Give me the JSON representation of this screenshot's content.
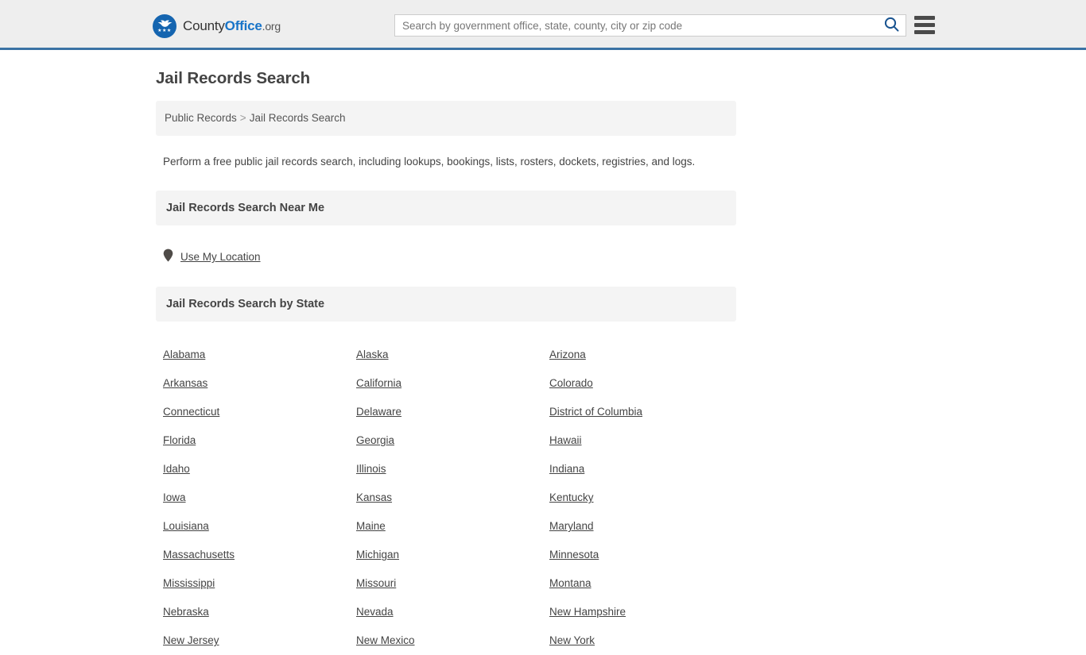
{
  "header": {
    "logo": {
      "icon": "eagle-seal-icon",
      "text_county": "County",
      "text_office": "Office",
      "text_org": ".org"
    },
    "search": {
      "placeholder": "Search by government office, state, county, city or zip code",
      "value": "",
      "icon": "search-icon"
    },
    "menu_icon": "hamburger-menu-icon",
    "accent_color": "#3b72a4"
  },
  "main": {
    "page_title": "Jail Records Search",
    "breadcrumb": {
      "parent": "Public Records",
      "separator": ">",
      "current": "Jail Records Search"
    },
    "intro": "Perform a free public jail records search, including lookups, bookings, lists, rosters, dockets, registries, and logs.",
    "near_me": {
      "heading": "Jail Records Search Near Me",
      "icon": "map-pin-icon",
      "link_label": "Use My Location"
    },
    "by_state": {
      "heading": "Jail Records Search by State",
      "states": [
        "Alabama",
        "Alaska",
        "Arizona",
        "Arkansas",
        "California",
        "Colorado",
        "Connecticut",
        "Delaware",
        "District of Columbia",
        "Florida",
        "Georgia",
        "Hawaii",
        "Idaho",
        "Illinois",
        "Indiana",
        "Iowa",
        "Kansas",
        "Kentucky",
        "Louisiana",
        "Maine",
        "Maryland",
        "Massachusetts",
        "Michigan",
        "Minnesota",
        "Mississippi",
        "Missouri",
        "Montana",
        "Nebraska",
        "Nevada",
        "New Hampshire",
        "New Jersey",
        "New Mexico",
        "New York"
      ]
    }
  }
}
